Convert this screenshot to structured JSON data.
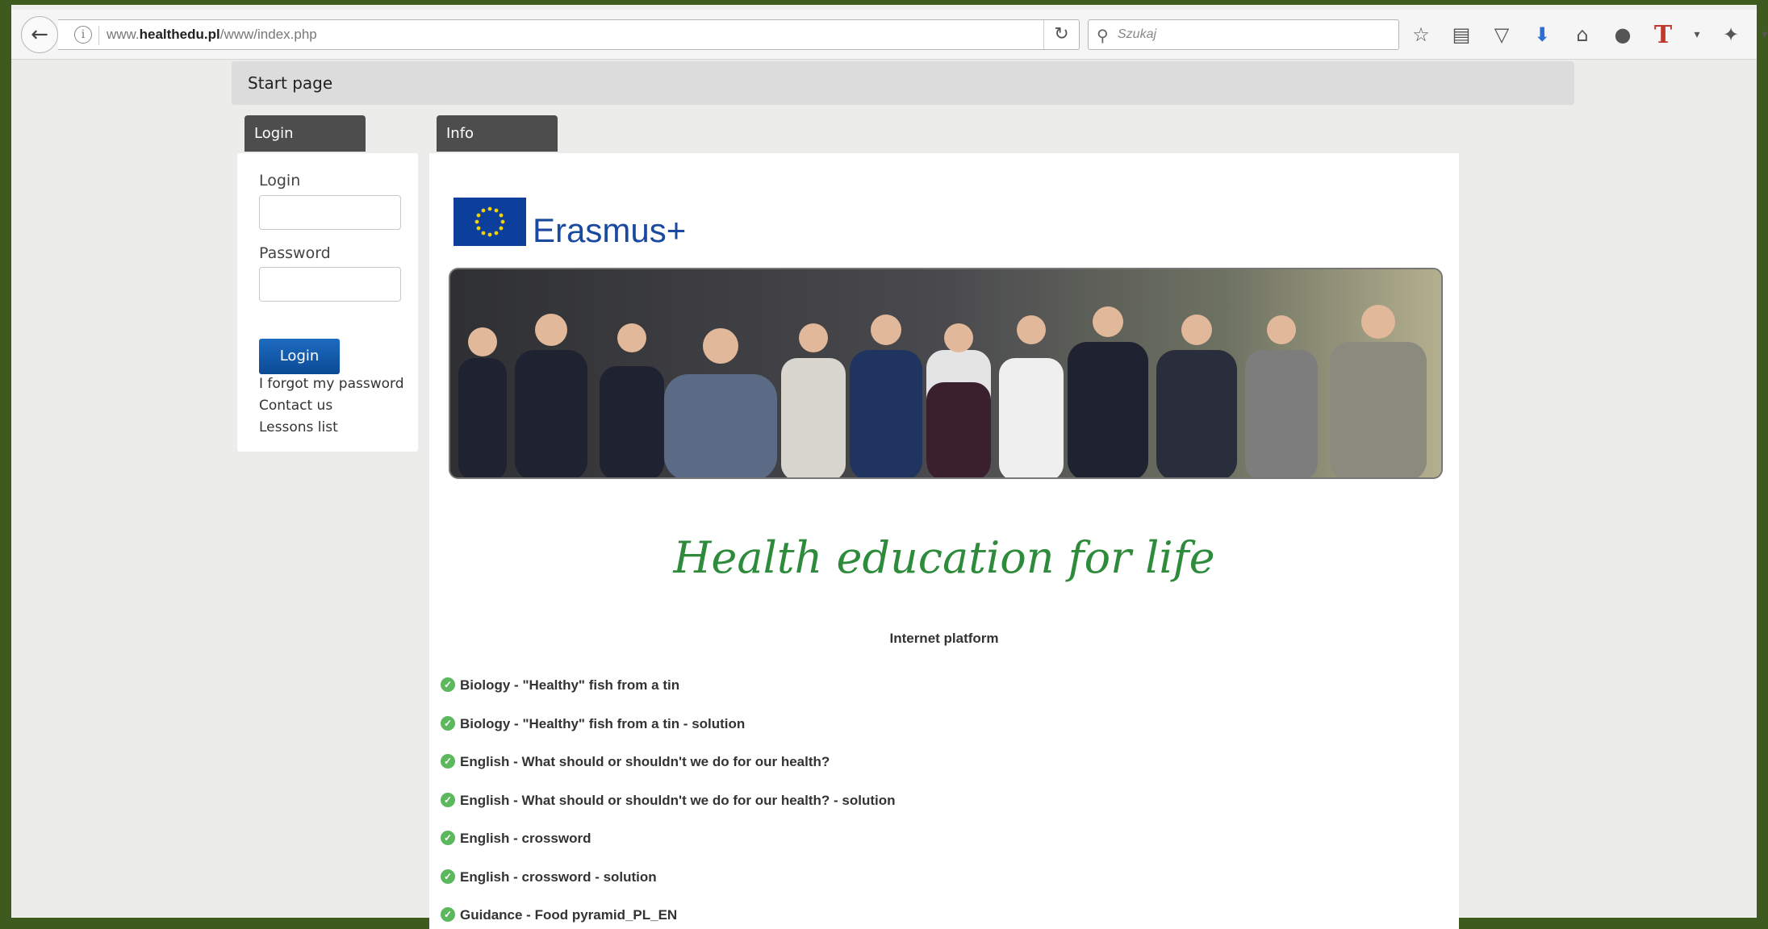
{
  "browser": {
    "url_prefix": "www.",
    "url_domain": "healthedu.pl",
    "url_path": "/www/index.php",
    "search_placeholder": "Szukaj"
  },
  "page": {
    "start_page": "Start page",
    "login_tab": "Login",
    "info_tab": "Info",
    "login_label": "Login",
    "password_label": "Password",
    "login_button": "Login",
    "links": [
      "I forgot my password",
      "Contact us",
      "Lessons list"
    ],
    "erasmus_text": "Erasmus+",
    "headline": "Health  education  for  life",
    "subheading": "Internet platform",
    "lessons": [
      "Biology - \"Healthy\"  fish from a tin",
      "Biology - \"Healthy\"  fish from a tin - solution",
      "English - What should or shouldn't we do for our health?",
      "English - What should or shouldn't we do for our health? - solution",
      "English - crossword",
      "English - crossword - solution",
      "Guidance - Food pyramid_PL_EN"
    ]
  }
}
